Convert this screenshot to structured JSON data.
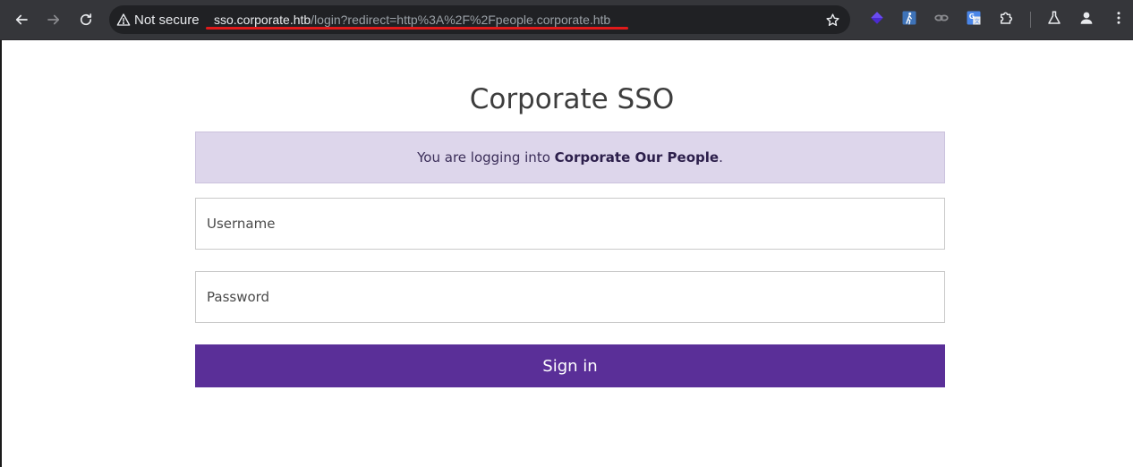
{
  "browser": {
    "security_label": "Not secure",
    "url_host": "sso.corporate.htb",
    "url_path": "/login?redirect=http%3A%2F%2Fpeople.corporate.htb",
    "icons": {
      "back": "arrow-left-icon",
      "forward": "arrow-right-icon",
      "reload": "reload-icon",
      "bookmark": "star-icon",
      "extensions": [
        "purple-diamond-extension-icon",
        "blue-figure-extension-icon",
        "link-extension-icon",
        "translate-extension-icon",
        "puzzle-icon"
      ],
      "labs": "flask-icon",
      "profile": "person-icon",
      "menu": "more-vertical-icon"
    },
    "colors": {
      "annotation_underline": "#e01a1a"
    }
  },
  "login": {
    "title": "Corporate SSO",
    "notice_prefix": "You are logging into ",
    "notice_app": "Corporate Our People",
    "notice_suffix": ".",
    "username_placeholder": "Username",
    "password_placeholder": "Password",
    "submit_label": "Sign in",
    "colors": {
      "accent": "#5a2f98",
      "notice_background": "#ddd6eb"
    }
  }
}
